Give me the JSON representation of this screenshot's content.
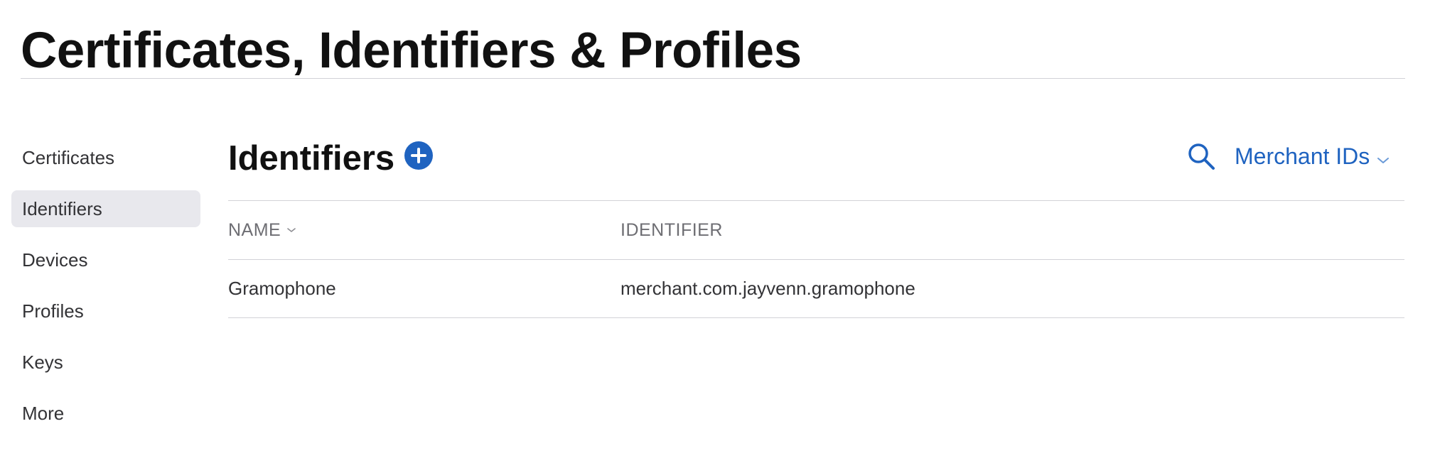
{
  "header": {
    "title": "Certificates, Identifiers & Profiles"
  },
  "sidebar": {
    "items": [
      {
        "label": "Certificates",
        "selected": false
      },
      {
        "label": "Identifiers",
        "selected": true
      },
      {
        "label": "Devices",
        "selected": false
      },
      {
        "label": "Profiles",
        "selected": false
      },
      {
        "label": "Keys",
        "selected": false
      },
      {
        "label": "More",
        "selected": false
      }
    ]
  },
  "main": {
    "title": "Identifiers",
    "add_icon": "plus-circle-icon",
    "search_icon": "search-icon",
    "filter": {
      "selected": "Merchant IDs",
      "icon": "chevron-down-icon"
    },
    "table": {
      "columns": [
        {
          "label": "NAME",
          "sortable": true,
          "icon": "chevron-down-icon"
        },
        {
          "label": "IDENTIFIER",
          "sortable": false
        }
      ],
      "rows": [
        {
          "name": "Gramophone",
          "identifier": "merchant.com.jayvenn.gramophone"
        }
      ]
    }
  },
  "colors": {
    "accent": "#1f63c0",
    "selected_bg": "#e8e8ed",
    "divider": "#d2d2d7",
    "header_text": "#6e6e73",
    "body_text": "#333336"
  }
}
